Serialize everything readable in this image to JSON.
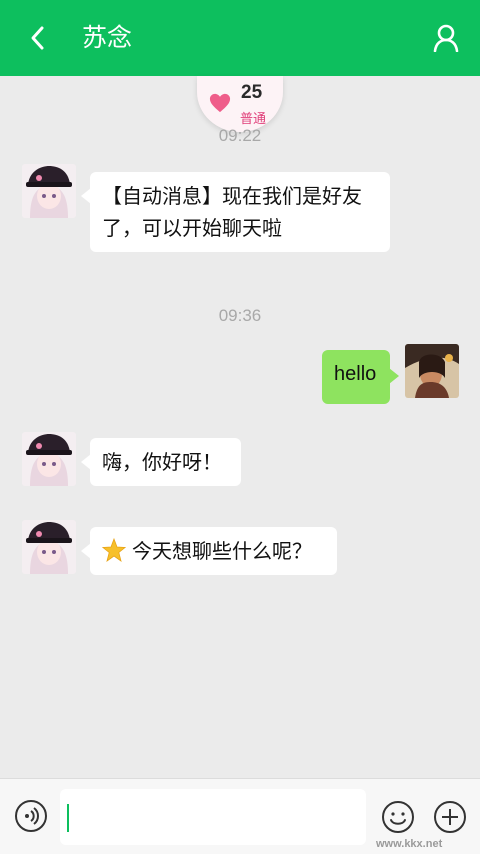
{
  "header": {
    "title": "苏念",
    "back_icon": "chevron-left-icon",
    "profile_icon": "person-icon",
    "color": "#0dbf5e"
  },
  "intimacy": {
    "level": "25",
    "label": "普通",
    "icon": "heart-icon"
  },
  "timestamps": [
    "09:22",
    "09:36"
  ],
  "messages": [
    {
      "side": "left",
      "text": "【自动消息】现在我们是好友了，可以开始聊天啦"
    },
    {
      "side": "right",
      "text": "hello"
    },
    {
      "side": "left",
      "text": "嗨，你好呀！"
    },
    {
      "side": "left",
      "emoji": "star-icon",
      "text": "今天想聊些什么呢？"
    }
  ],
  "input_bar": {
    "value": "",
    "voice_icon": "voice-icon",
    "emoji_icon": "smiley-icon",
    "plus_icon": "plus-circle-icon"
  },
  "watermark": "www.kkx.net",
  "colors": {
    "accent": "#0dbf5e",
    "sent_bubble": "#8ee35f",
    "received_bubble": "#ffffff",
    "background": "#ebebeb"
  }
}
